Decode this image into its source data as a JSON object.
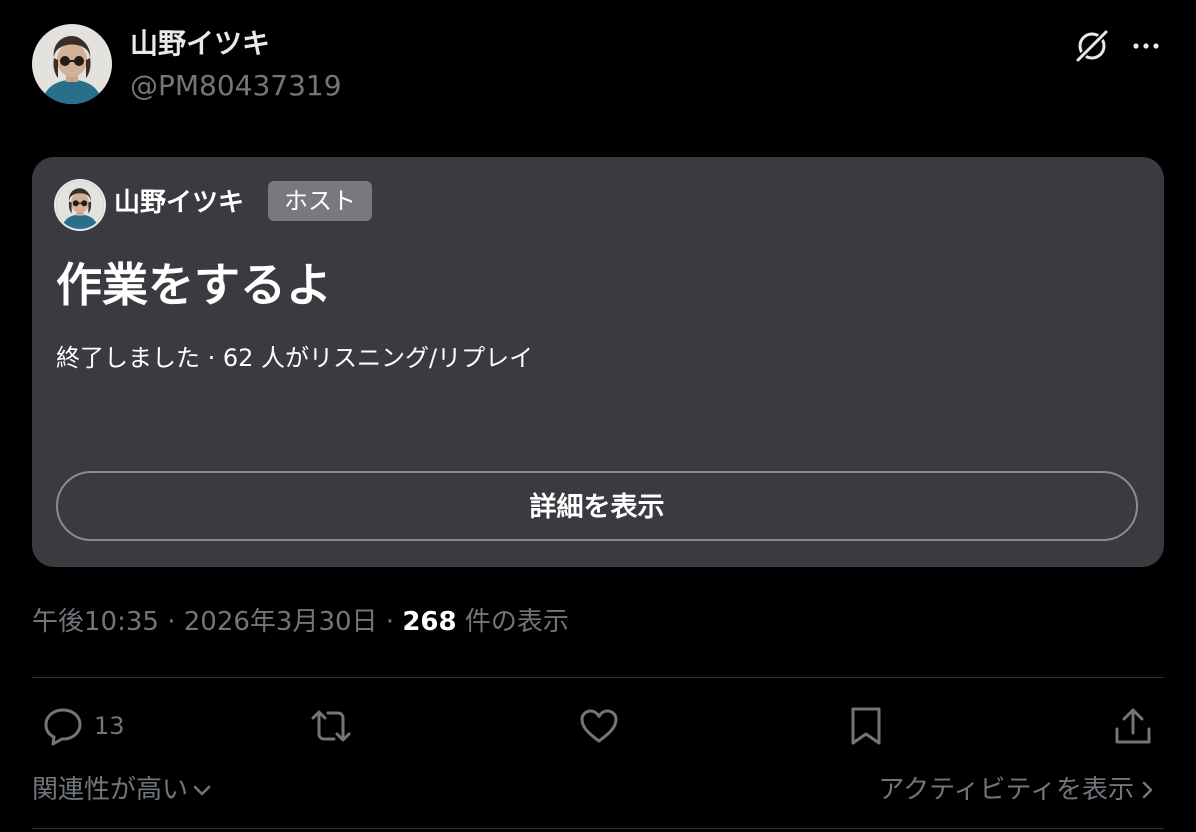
{
  "post": {
    "author_name": "山野イツキ",
    "author_handle": "@PM80437319",
    "icons": {
      "avatar": "avatar-portrait",
      "grok": "grok-icon",
      "more": "more-icon"
    }
  },
  "space": {
    "host_name": "山野イツキ",
    "host_badge": "ホスト",
    "title": "作業をするよ",
    "status": "終了しました · 62 人がリスニング/リプレイ",
    "details_button": "詳細を表示",
    "card_color": "#3c3a40"
  },
  "meta": {
    "time": "午後10:35",
    "separator": " · ",
    "date": "2026年3月30日",
    "views_count": "268",
    "views_label": " 件の表示"
  },
  "actions": {
    "reply_count": "13",
    "icons": [
      "reply-icon",
      "retweet-icon",
      "like-icon",
      "bookmark-icon",
      "share-icon"
    ]
  },
  "footer": {
    "sort_label": "関連性が高い",
    "activity_label": "アクティビティを表示"
  },
  "colors": {
    "background": "#000000",
    "text_primary": "#e7e9ea",
    "text_secondary": "#71767b",
    "divider": "#2f3336"
  }
}
